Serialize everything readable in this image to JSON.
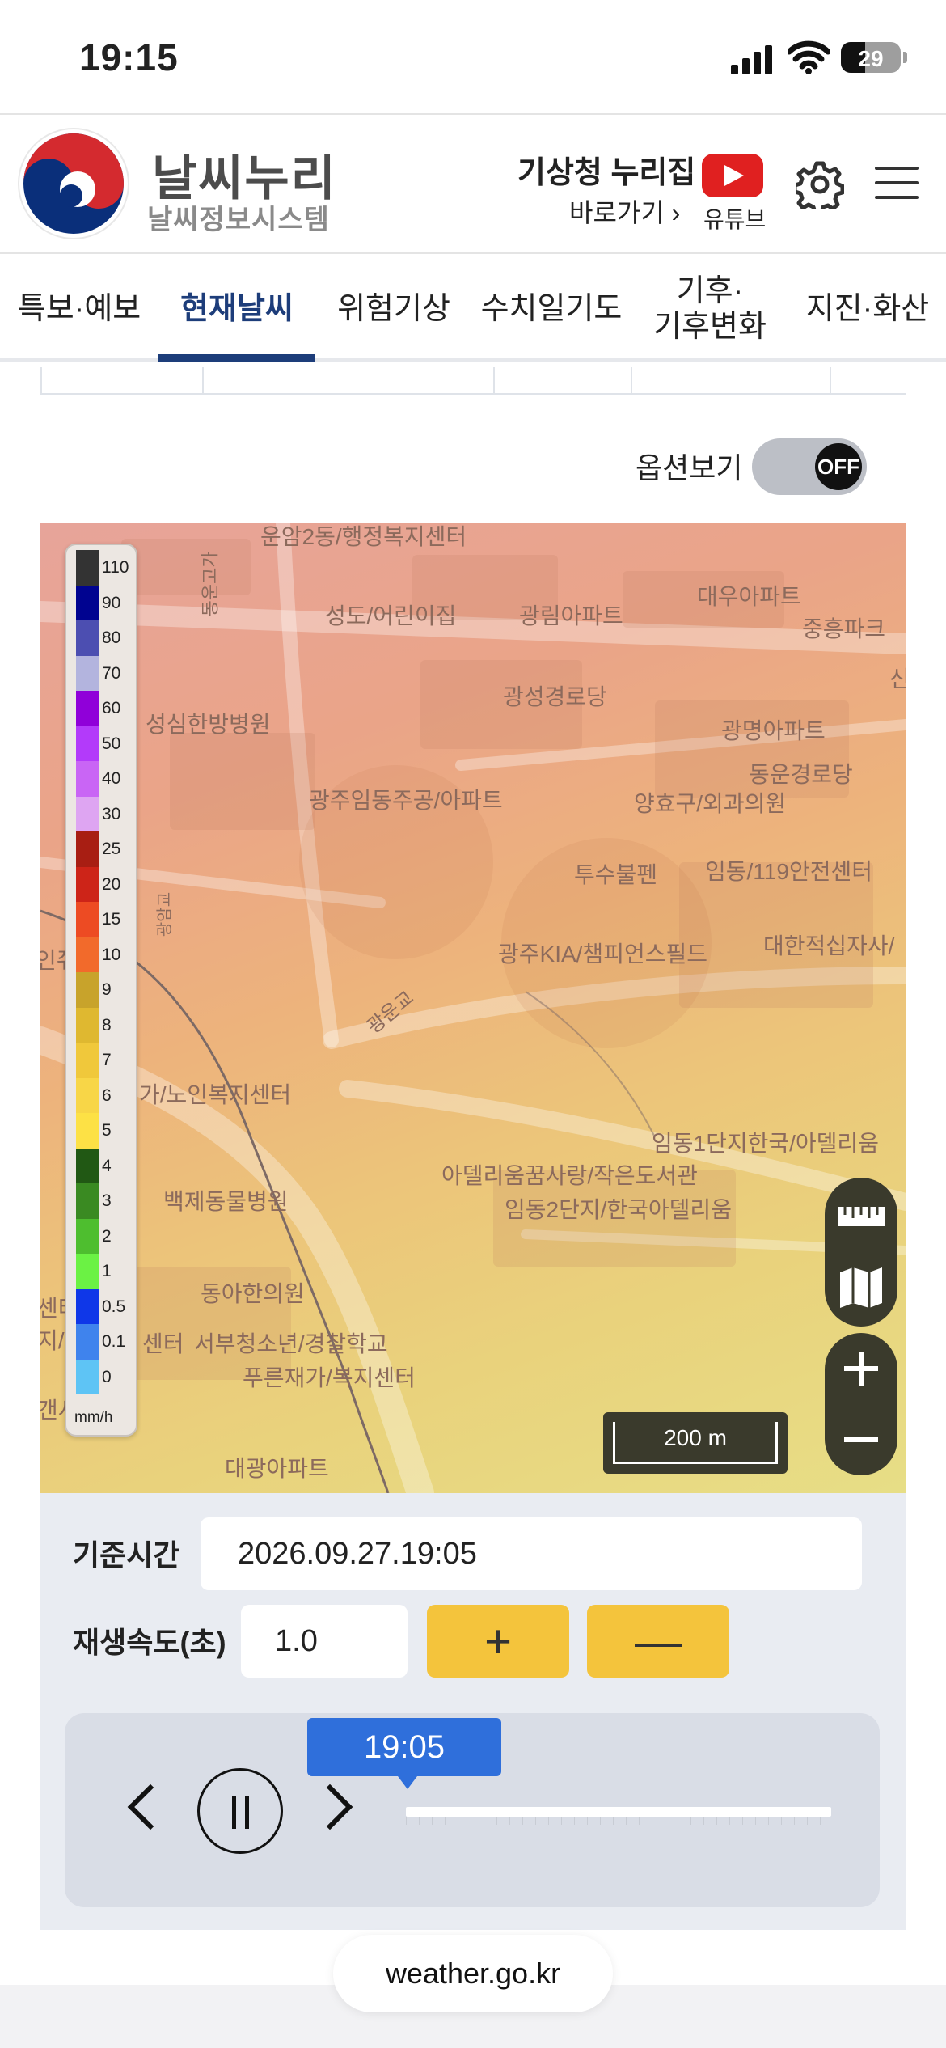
{
  "status_bar": {
    "time": "19:15",
    "battery": "29"
  },
  "header": {
    "brand_title": "날씨누리",
    "brand_subtitle": "날씨정보시스템",
    "nurizip_title": "기상청 누리집",
    "nurizip_link": "바로가기 ›",
    "youtube_label": "유튜브",
    "icons": [
      "settings-gear-icon",
      "hamburger-menu-icon",
      "youtube-icon"
    ]
  },
  "nav": {
    "tabs": [
      {
        "label": "특보·예보"
      },
      {
        "label": "현재날씨",
        "active": true
      },
      {
        "label": "위험기상"
      },
      {
        "label": "수치일기도"
      },
      {
        "label": "기후·\n기후변화"
      },
      {
        "label": "지진·화산"
      }
    ]
  },
  "options": {
    "label": "옵션보기",
    "toggle_state": "OFF"
  },
  "map": {
    "labels": [
      "운암2동/행정복지센터",
      "성도/어린이집",
      "광림아파트",
      "대우아파트",
      "중흥파크",
      "신",
      "광성경로당",
      "성심한방병원",
      "광명아파트",
      "동운경로당",
      "광주임동주공/아파트",
      "양효구/외과의원",
      "투수불펜",
      "임동/119안전센터",
      "광주KIA/챔피언스필드",
      "대한적십자사/",
      "광운교",
      "동운고가",
      "광암교",
      "인쥐",
      "가/노인복지센터",
      "임동1단지한국/아델리움",
      "아델리움꿈사랑/작은도서관",
      "임동2단지/한국아델리움",
      "백제동물병원",
      "동아한의원",
      "센터",
      "지/",
      "센터",
      "서부청소년/경찰학교",
      "푸른재가/복지센터",
      "갠사",
      "대광아파트"
    ],
    "legend": {
      "unit": "mm/h",
      "items": [
        {
          "value": "110",
          "color": "#333333"
        },
        {
          "value": "90",
          "color": "#000390"
        },
        {
          "value": "80",
          "color": "#4c4eb1"
        },
        {
          "value": "70",
          "color": "#b3b4de"
        },
        {
          "value": "60",
          "color": "#9000d9"
        },
        {
          "value": "50",
          "color": "#b33afa"
        },
        {
          "value": "40",
          "color": "#c965f5"
        },
        {
          "value": "30",
          "color": "#dea5f2"
        },
        {
          "value": "25",
          "color": "#a81e13"
        },
        {
          "value": "20",
          "color": "#cd2418"
        },
        {
          "value": "15",
          "color": "#ed4b23"
        },
        {
          "value": "10",
          "color": "#f26a2b"
        },
        {
          "value": "9",
          "color": "#c8a32b"
        },
        {
          "value": "8",
          "color": "#dfb830"
        },
        {
          "value": "7",
          "color": "#f0c83b"
        },
        {
          "value": "6",
          "color": "#f8d647"
        },
        {
          "value": "5",
          "color": "#fde145"
        },
        {
          "value": "4",
          "color": "#215814"
        },
        {
          "value": "3",
          "color": "#3a8a22"
        },
        {
          "value": "2",
          "color": "#4ebe2f"
        },
        {
          "value": "1",
          "color": "#6bf244"
        },
        {
          "value": "0.5",
          "color": "#0f37e8"
        },
        {
          "value": "0.1",
          "color": "#3f83ed"
        },
        {
          "value": "0",
          "color": "#5ec4f5"
        }
      ]
    },
    "scale_label": "200 m",
    "tools": [
      "ruler-icon",
      "map-book-icon",
      "zoom-in-icon",
      "zoom-out-icon"
    ]
  },
  "controls": {
    "base_time_label": "기준시간",
    "base_time_value": "2026.09.27.19:05",
    "speed_label": "재생속도(초)",
    "speed_value": "1.0",
    "plus_label": "+",
    "minus_label": "—",
    "current_time": "19:05",
    "timeline_position": 0
  },
  "browser": {
    "url": "weather.go.kr"
  }
}
